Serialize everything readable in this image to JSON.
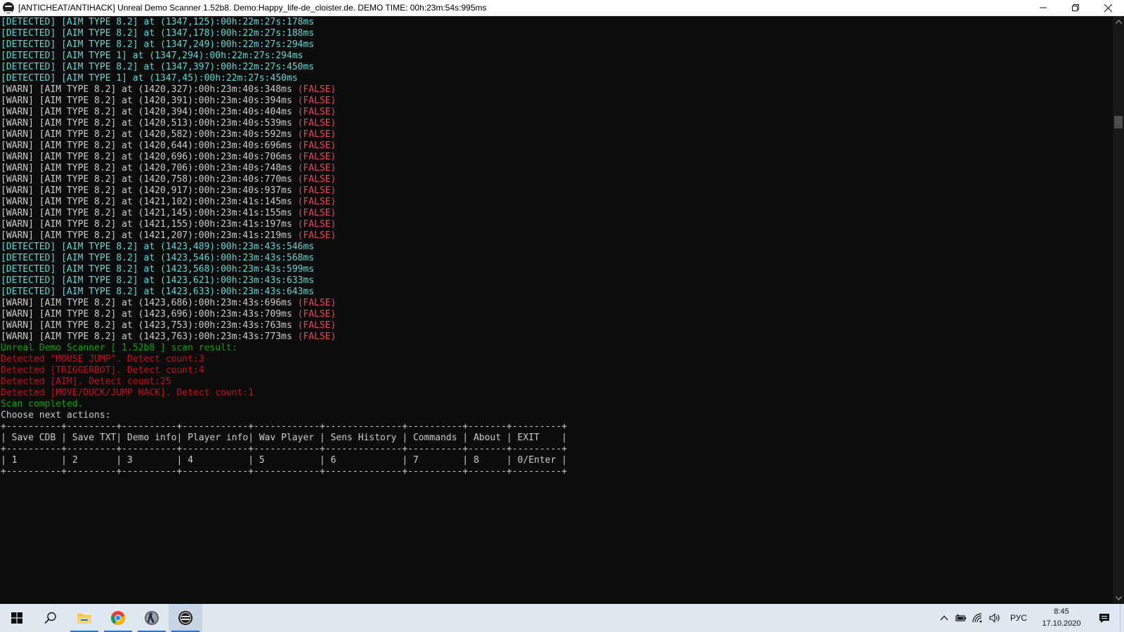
{
  "window": {
    "title": "[ANTICHEAT/ANTIHACK] Unreal Demo Scanner 1.52b8. Demo:Happy_life-de_cloister.de. DEMO TIME: 00h:23m:54s:995ms",
    "minimize_icon": "minimize-icon",
    "restore_icon": "restore-icon",
    "close_icon": "close-icon"
  },
  "console": {
    "colors": {
      "detected": "#61d6d6",
      "warn": "#cccccc",
      "false_tag": "#e74856",
      "result": "#13a10e",
      "detect_count": "#c50f1f",
      "background": "#0c0c0c"
    },
    "lines": [
      {
        "segments": [
          {
            "text": "[DETECTED] [AIM TYPE 8.2] at (1347,125):00h:22m:27s:178ms",
            "style": "cyan"
          }
        ]
      },
      {
        "segments": [
          {
            "text": "[DETECTED] [AIM TYPE 8.2] at (1347,178):00h:22m:27s:188ms",
            "style": "cyan"
          }
        ]
      },
      {
        "segments": [
          {
            "text": "[DETECTED] [AIM TYPE 8.2] at (1347,249):00h:22m:27s:294ms",
            "style": "cyan"
          }
        ]
      },
      {
        "segments": [
          {
            "text": "[DETECTED] [AIM TYPE 1] at (1347,294):00h:22m:27s:294ms",
            "style": "cyan"
          }
        ]
      },
      {
        "segments": [
          {
            "text": "[DETECTED] [AIM TYPE 8.2] at (1347,397):00h:22m:27s:450ms",
            "style": "cyan"
          }
        ]
      },
      {
        "segments": [
          {
            "text": "[DETECTED] [AIM TYPE 1] at (1347,45):00h:22m:27s:450ms",
            "style": "cyan"
          }
        ]
      },
      {
        "segments": [
          {
            "text": "[WARN] [AIM TYPE 8.2] at (1420,327):00h:23m:40s:348ms ",
            "style": "white"
          },
          {
            "text": "(FALSE)",
            "style": "red"
          }
        ]
      },
      {
        "segments": [
          {
            "text": "[WARN] [AIM TYPE 8.2] at (1420,391):00h:23m:40s:394ms ",
            "style": "white"
          },
          {
            "text": "(FALSE)",
            "style": "red"
          }
        ]
      },
      {
        "segments": [
          {
            "text": "[WARN] [AIM TYPE 8.2] at (1420,394):00h:23m:40s:404ms ",
            "style": "white"
          },
          {
            "text": "(FALSE)",
            "style": "red"
          }
        ]
      },
      {
        "segments": [
          {
            "text": "[WARN] [AIM TYPE 8.2] at (1420,513):00h:23m:40s:539ms ",
            "style": "white"
          },
          {
            "text": "(FALSE)",
            "style": "red"
          }
        ]
      },
      {
        "segments": [
          {
            "text": "[WARN] [AIM TYPE 8.2] at (1420,582):00h:23m:40s:592ms ",
            "style": "white"
          },
          {
            "text": "(FALSE)",
            "style": "red"
          }
        ]
      },
      {
        "segments": [
          {
            "text": "[WARN] [AIM TYPE 8.2] at (1420,644):00h:23m:40s:696ms ",
            "style": "white"
          },
          {
            "text": "(FALSE)",
            "style": "red"
          }
        ]
      },
      {
        "segments": [
          {
            "text": "[WARN] [AIM TYPE 8.2] at (1420,696):00h:23m:40s:706ms ",
            "style": "white"
          },
          {
            "text": "(FALSE)",
            "style": "red"
          }
        ]
      },
      {
        "segments": [
          {
            "text": "[WARN] [AIM TYPE 8.2] at (1420,706):00h:23m:40s:748ms ",
            "style": "white"
          },
          {
            "text": "(FALSE)",
            "style": "red"
          }
        ]
      },
      {
        "segments": [
          {
            "text": "[WARN] [AIM TYPE 8.2] at (1420,758):00h:23m:40s:770ms ",
            "style": "white"
          },
          {
            "text": "(FALSE)",
            "style": "red"
          }
        ]
      },
      {
        "segments": [
          {
            "text": "[WARN] [AIM TYPE 8.2] at (1420,917):00h:23m:40s:937ms ",
            "style": "white"
          },
          {
            "text": "(FALSE)",
            "style": "red"
          }
        ]
      },
      {
        "segments": [
          {
            "text": "[WARN] [AIM TYPE 8.2] at (1421,102):00h:23m:41s:145ms ",
            "style": "white"
          },
          {
            "text": "(FALSE)",
            "style": "red"
          }
        ]
      },
      {
        "segments": [
          {
            "text": "[WARN] [AIM TYPE 8.2] at (1421,145):00h:23m:41s:155ms ",
            "style": "white"
          },
          {
            "text": "(FALSE)",
            "style": "red"
          }
        ]
      },
      {
        "segments": [
          {
            "text": "[WARN] [AIM TYPE 8.2] at (1421,155):00h:23m:41s:197ms ",
            "style": "white"
          },
          {
            "text": "(FALSE)",
            "style": "red"
          }
        ]
      },
      {
        "segments": [
          {
            "text": "[WARN] [AIM TYPE 8.2] at (1421,207):00h:23m:41s:219ms ",
            "style": "white"
          },
          {
            "text": "(FALSE)",
            "style": "red"
          }
        ]
      },
      {
        "segments": [
          {
            "text": "[DETECTED] [AIM TYPE 8.2] at (1423,489):00h:23m:43s:546ms",
            "style": "cyan"
          }
        ]
      },
      {
        "segments": [
          {
            "text": "[DETECTED] [AIM TYPE 8.2] at (1423,546):00h:23m:43s:568ms",
            "style": "cyan"
          }
        ]
      },
      {
        "segments": [
          {
            "text": "[DETECTED] [AIM TYPE 8.2] at (1423,568):00h:23m:43s:599ms",
            "style": "cyan"
          }
        ]
      },
      {
        "segments": [
          {
            "text": "[DETECTED] [AIM TYPE 8.2] at (1423,621):00h:23m:43s:633ms",
            "style": "cyan"
          }
        ]
      },
      {
        "segments": [
          {
            "text": "[DETECTED] [AIM TYPE 8.2] at (1423,633):00h:23m:43s:643ms",
            "style": "cyan"
          }
        ]
      },
      {
        "segments": [
          {
            "text": "[WARN] [AIM TYPE 8.2] at (1423,686):00h:23m:43s:696ms ",
            "style": "white"
          },
          {
            "text": "(FALSE)",
            "style": "red"
          }
        ]
      },
      {
        "segments": [
          {
            "text": "[WARN] [AIM TYPE 8.2] at (1423,696):00h:23m:43s:709ms ",
            "style": "white"
          },
          {
            "text": "(FALSE)",
            "style": "red"
          }
        ]
      },
      {
        "segments": [
          {
            "text": "[WARN] [AIM TYPE 8.2] at (1423,753):00h:23m:43s:763ms ",
            "style": "white"
          },
          {
            "text": "(FALSE)",
            "style": "red"
          }
        ]
      },
      {
        "segments": [
          {
            "text": "[WARN] [AIM TYPE 8.2] at (1423,763):00h:23m:43s:773ms ",
            "style": "white"
          },
          {
            "text": "(FALSE)",
            "style": "red"
          }
        ]
      },
      {
        "segments": [
          {
            "text": "Unreal Demo Scanner [ 1.52b8 ] scan result:",
            "style": "green"
          }
        ]
      },
      {
        "segments": [
          {
            "text": "Detected \"MOUSE JUMP\". Detect count:3",
            "style": "dred"
          }
        ]
      },
      {
        "segments": [
          {
            "text": "Detected [TRIGGERBOT]. Detect count:4",
            "style": "dred"
          }
        ]
      },
      {
        "segments": [
          {
            "text": "Detected [AIM]. Detect count:25",
            "style": "dred"
          }
        ]
      },
      {
        "segments": [
          {
            "text": "Detected [MOVE/DUCK/JUMP HACK]. Detect count:1",
            "style": "dred"
          }
        ]
      },
      {
        "segments": [
          {
            "text": "Scan completed.",
            "style": "green"
          }
        ]
      },
      {
        "segments": [
          {
            "text": "Choose next actions:",
            "style": "white"
          }
        ]
      }
    ],
    "menu_table": {
      "border": "+----------+---------+----------+------------+------------+--------------+----------+-------+---------+",
      "headers": [
        "Save CDB",
        "Save TXT",
        "Demo info",
        "Player info",
        "Wav Player",
        "Sens History",
        "Commands",
        "About",
        "EXIT"
      ],
      "keys": [
        "1",
        "2",
        "3",
        "4",
        "5",
        "6",
        "7",
        "8",
        "0/Enter"
      ],
      "widths": [
        10,
        9,
        10,
        12,
        12,
        14,
        10,
        7,
        9
      ]
    }
  },
  "scrollbar": {
    "up_icon": "scroll-up-icon",
    "down_icon": "scroll-down-icon",
    "position_fraction": 0.16
  },
  "taskbar": {
    "items": [
      {
        "name": "start-button",
        "icon": "windows-logo-icon"
      },
      {
        "name": "search-button",
        "icon": "search-icon"
      },
      {
        "name": "file-explorer",
        "icon": "folder-icon"
      },
      {
        "name": "chrome",
        "icon": "chrome-icon"
      },
      {
        "name": "counter-strike",
        "icon": "cs-icon"
      },
      {
        "name": "demo-scanner",
        "icon": "scanner-icon"
      }
    ],
    "tray": {
      "language": "РУС",
      "time": "8:45",
      "date": "17.10.2020"
    }
  }
}
